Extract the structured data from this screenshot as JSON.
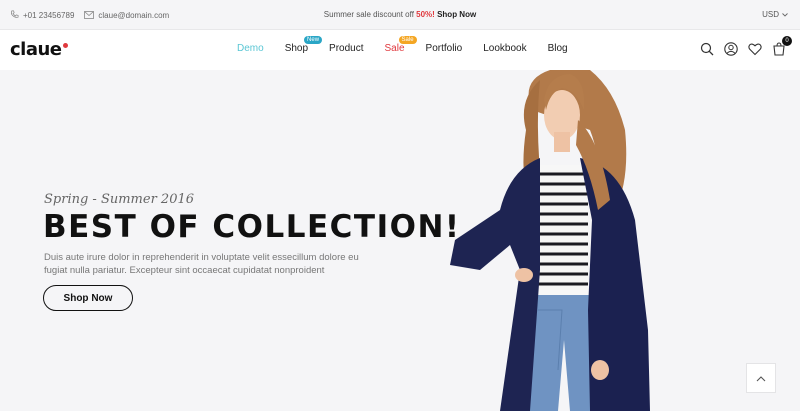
{
  "topbar": {
    "phone": "+01 23456789",
    "email": "claue@domain.com",
    "promo_text": "Summer sale discount off",
    "promo_percent": "50%!",
    "promo_link": "Shop Now",
    "currency": "USD"
  },
  "header": {
    "logo": "claue",
    "nav": [
      {
        "label": "Demo"
      },
      {
        "label": "Shop",
        "badge": "New"
      },
      {
        "label": "Product"
      },
      {
        "label": "Sale",
        "badge": "Sale"
      },
      {
        "label": "Portfolio"
      },
      {
        "label": "Lookbook"
      },
      {
        "label": "Blog"
      }
    ],
    "cart_count": "0"
  },
  "hero": {
    "subtitle": "Spring - Summer 2016",
    "headline": "BEST OF COLLECTION!",
    "description": "Duis aute irure dolor in reprehenderit in voluptate velit essecillum dolore eu fugiat nulla pariatur. Excepteur sint occaecat cupidatat nonproident",
    "button": "Shop Now"
  },
  "colors": {
    "accent": "#5ac6d4",
    "sale": "#e0393e",
    "new_badge": "#2aa6c6",
    "sale_badge": "#f4a623",
    "background": "#f5f5f7"
  },
  "icons": [
    "phone-icon",
    "mail-icon",
    "chevron-down-icon",
    "search-icon",
    "user-icon",
    "heart-icon",
    "cart-icon",
    "chevron-up-icon"
  ]
}
